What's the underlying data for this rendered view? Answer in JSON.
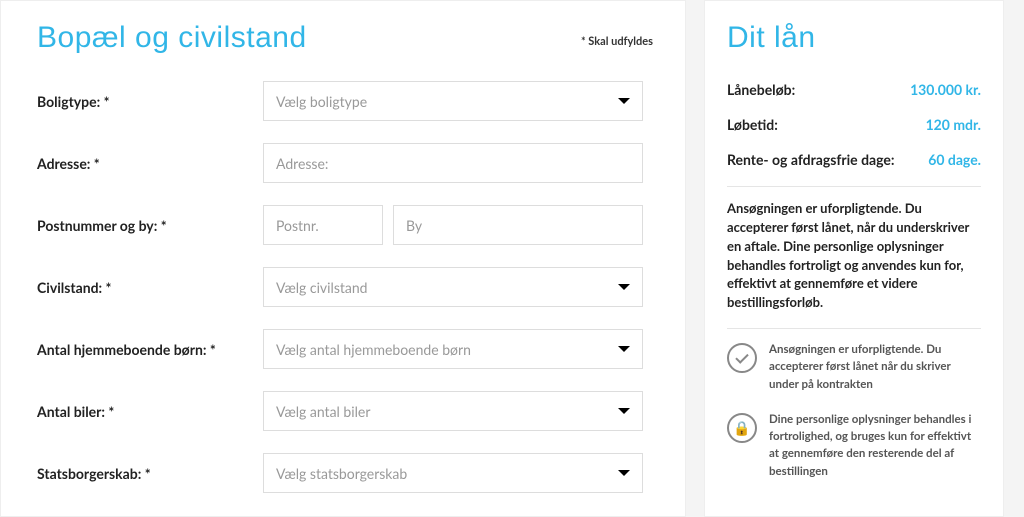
{
  "left": {
    "title": "Bopæl og civilstand",
    "required_note": "* Skal udfyldes",
    "fields": {
      "housing": {
        "label": "Boligtype: *",
        "placeholder": "Vælg boligtype"
      },
      "address": {
        "label": "Adresse: *",
        "placeholder": "Adresse:"
      },
      "postal": {
        "label": "Postnummer og by: *",
        "postal_ph": "Postnr.",
        "city_ph": "By"
      },
      "marital": {
        "label": "Civilstand: *",
        "placeholder": "Vælg civilstand"
      },
      "children": {
        "label": "Antal hjemmeboende børn: *",
        "placeholder": "Vælg antal hjemmeboende børn"
      },
      "cars": {
        "label": "Antal biler: *",
        "placeholder": "Vælg antal biler"
      },
      "citizen": {
        "label": "Statsborgerskab: *",
        "placeholder": "Vælg statsborgerskab"
      }
    }
  },
  "right": {
    "title": "Dit lån",
    "rows": {
      "amount": {
        "label": "Lånebeløb:",
        "value": "130.000 kr."
      },
      "duration": {
        "label": "Løbetid:",
        "value": "120 mdr."
      },
      "gracedays": {
        "label": "Rente- og afdragsfrie dage:",
        "value": "60 dage."
      }
    },
    "disclaimer": "Ansøgningen er uforpligtende. Du accepterer først lånet, når du underskriver en aftale. Dine personlige oplysninger behandles fortroligt og anvendes kun for, effektivt at gennemføre et videre bestillingsforløb.",
    "info": {
      "a": "Ansøgningen er uforpligtende. Du accepterer først lånet når du skriver under på kontrakten",
      "b": "Dine personlige oplysninger behandles i fortrolighed, og bruges kun for effektivt at gennemføre den resterende del af bestillingen"
    }
  }
}
